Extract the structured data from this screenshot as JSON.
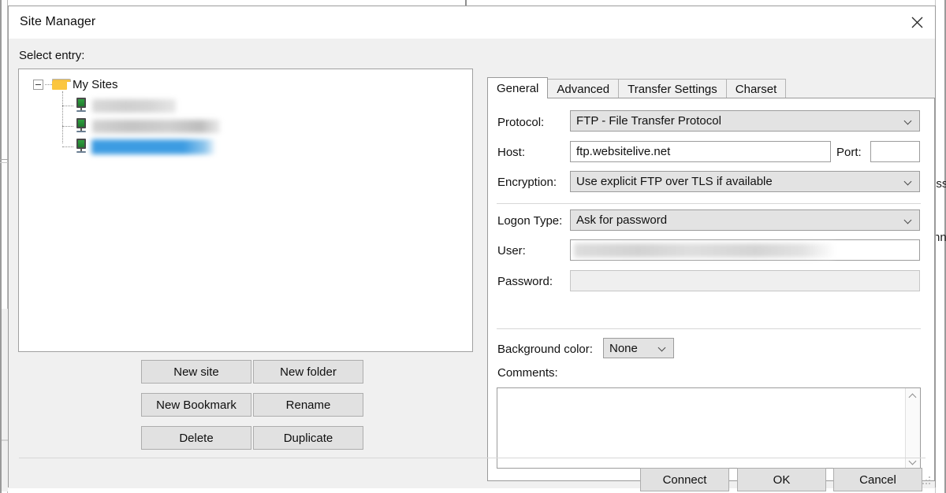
{
  "window": {
    "title": "Site Manager",
    "close_icon": "close-icon"
  },
  "left_pane": {
    "select_label": "Select entry:",
    "tree": {
      "root": {
        "label": "My Sites",
        "icon": "folder-icon",
        "expander": "collapse-expander-icon",
        "expanded": true
      },
      "children": [
        {
          "label": "",
          "icon": "server-icon",
          "redacted": true,
          "selected": false
        },
        {
          "label": "",
          "icon": "server-icon",
          "redacted": true,
          "selected": false
        },
        {
          "label": "",
          "icon": "server-icon",
          "redacted": true,
          "selected": true
        }
      ]
    },
    "buttons": [
      {
        "label": "New site"
      },
      {
        "label": "New folder"
      },
      {
        "label": "New Bookmark"
      },
      {
        "label": "Rename"
      },
      {
        "label": "Delete"
      },
      {
        "label": "Duplicate"
      }
    ]
  },
  "right_pane": {
    "tabs": [
      {
        "label": "General",
        "active": true
      },
      {
        "label": "Advanced",
        "active": false
      },
      {
        "label": "Transfer Settings",
        "active": false
      },
      {
        "label": "Charset",
        "active": false
      }
    ],
    "general": {
      "protocol_label": "Protocol:",
      "protocol_value": "FTP - File Transfer Protocol",
      "host_label": "Host:",
      "host_value": "ftp.websitelive.net",
      "port_label": "Port:",
      "port_value": "",
      "encryption_label": "Encryption:",
      "encryption_value": "Use explicit FTP over TLS if available",
      "logon_type_label": "Logon Type:",
      "logon_type_value": "Ask for password",
      "user_label": "User:",
      "user_value": "",
      "password_label": "Password:",
      "password_value": "",
      "background_color_label": "Background color:",
      "background_color_value": "None",
      "comments_label": "Comments:",
      "comments_value": ""
    }
  },
  "footer": {
    "buttons": [
      {
        "label": "Connect"
      },
      {
        "label": "OK"
      },
      {
        "label": "Cancel"
      }
    ],
    "resize_grip": "resize-grip-icon"
  },
  "background_window": {
    "text_fragment_1": "issi",
    "text_fragment_2": "nne"
  },
  "colors": {
    "selection_blue": "#3d9ce2",
    "dialog_bg": "#f0f0f0",
    "panel_white": "#ffffff",
    "button_face": "#e1e1e1",
    "combo_face": "#e3e3e3",
    "border": "#9a9a9a",
    "folder_yellow": "#fbc63f",
    "server_green": "#2fa13f"
  }
}
